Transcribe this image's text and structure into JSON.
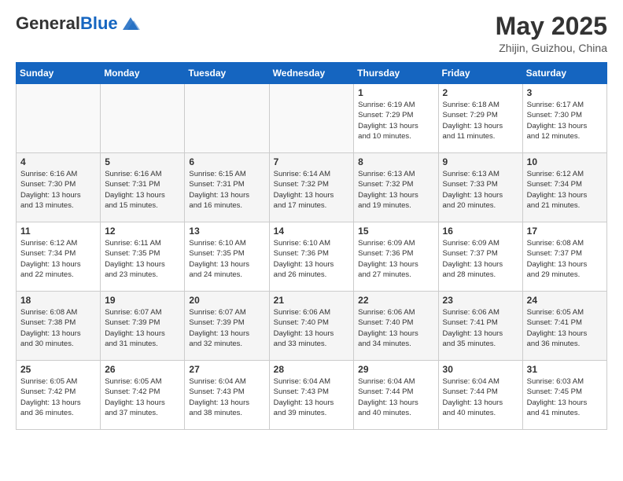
{
  "header": {
    "logo_general": "General",
    "logo_blue": "Blue",
    "month_title": "May 2025",
    "location": "Zhijin, Guizhou, China"
  },
  "weekdays": [
    "Sunday",
    "Monday",
    "Tuesday",
    "Wednesday",
    "Thursday",
    "Friday",
    "Saturday"
  ],
  "weeks": [
    [
      {
        "day": "",
        "info": ""
      },
      {
        "day": "",
        "info": ""
      },
      {
        "day": "",
        "info": ""
      },
      {
        "day": "",
        "info": ""
      },
      {
        "day": "1",
        "info": "Sunrise: 6:19 AM\nSunset: 7:29 PM\nDaylight: 13 hours\nand 10 minutes."
      },
      {
        "day": "2",
        "info": "Sunrise: 6:18 AM\nSunset: 7:29 PM\nDaylight: 13 hours\nand 11 minutes."
      },
      {
        "day": "3",
        "info": "Sunrise: 6:17 AM\nSunset: 7:30 PM\nDaylight: 13 hours\nand 12 minutes."
      }
    ],
    [
      {
        "day": "4",
        "info": "Sunrise: 6:16 AM\nSunset: 7:30 PM\nDaylight: 13 hours\nand 13 minutes."
      },
      {
        "day": "5",
        "info": "Sunrise: 6:16 AM\nSunset: 7:31 PM\nDaylight: 13 hours\nand 15 minutes."
      },
      {
        "day": "6",
        "info": "Sunrise: 6:15 AM\nSunset: 7:31 PM\nDaylight: 13 hours\nand 16 minutes."
      },
      {
        "day": "7",
        "info": "Sunrise: 6:14 AM\nSunset: 7:32 PM\nDaylight: 13 hours\nand 17 minutes."
      },
      {
        "day": "8",
        "info": "Sunrise: 6:13 AM\nSunset: 7:32 PM\nDaylight: 13 hours\nand 19 minutes."
      },
      {
        "day": "9",
        "info": "Sunrise: 6:13 AM\nSunset: 7:33 PM\nDaylight: 13 hours\nand 20 minutes."
      },
      {
        "day": "10",
        "info": "Sunrise: 6:12 AM\nSunset: 7:34 PM\nDaylight: 13 hours\nand 21 minutes."
      }
    ],
    [
      {
        "day": "11",
        "info": "Sunrise: 6:12 AM\nSunset: 7:34 PM\nDaylight: 13 hours\nand 22 minutes."
      },
      {
        "day": "12",
        "info": "Sunrise: 6:11 AM\nSunset: 7:35 PM\nDaylight: 13 hours\nand 23 minutes."
      },
      {
        "day": "13",
        "info": "Sunrise: 6:10 AM\nSunset: 7:35 PM\nDaylight: 13 hours\nand 24 minutes."
      },
      {
        "day": "14",
        "info": "Sunrise: 6:10 AM\nSunset: 7:36 PM\nDaylight: 13 hours\nand 26 minutes."
      },
      {
        "day": "15",
        "info": "Sunrise: 6:09 AM\nSunset: 7:36 PM\nDaylight: 13 hours\nand 27 minutes."
      },
      {
        "day": "16",
        "info": "Sunrise: 6:09 AM\nSunset: 7:37 PM\nDaylight: 13 hours\nand 28 minutes."
      },
      {
        "day": "17",
        "info": "Sunrise: 6:08 AM\nSunset: 7:37 PM\nDaylight: 13 hours\nand 29 minutes."
      }
    ],
    [
      {
        "day": "18",
        "info": "Sunrise: 6:08 AM\nSunset: 7:38 PM\nDaylight: 13 hours\nand 30 minutes."
      },
      {
        "day": "19",
        "info": "Sunrise: 6:07 AM\nSunset: 7:39 PM\nDaylight: 13 hours\nand 31 minutes."
      },
      {
        "day": "20",
        "info": "Sunrise: 6:07 AM\nSunset: 7:39 PM\nDaylight: 13 hours\nand 32 minutes."
      },
      {
        "day": "21",
        "info": "Sunrise: 6:06 AM\nSunset: 7:40 PM\nDaylight: 13 hours\nand 33 minutes."
      },
      {
        "day": "22",
        "info": "Sunrise: 6:06 AM\nSunset: 7:40 PM\nDaylight: 13 hours\nand 34 minutes."
      },
      {
        "day": "23",
        "info": "Sunrise: 6:06 AM\nSunset: 7:41 PM\nDaylight: 13 hours\nand 35 minutes."
      },
      {
        "day": "24",
        "info": "Sunrise: 6:05 AM\nSunset: 7:41 PM\nDaylight: 13 hours\nand 36 minutes."
      }
    ],
    [
      {
        "day": "25",
        "info": "Sunrise: 6:05 AM\nSunset: 7:42 PM\nDaylight: 13 hours\nand 36 minutes."
      },
      {
        "day": "26",
        "info": "Sunrise: 6:05 AM\nSunset: 7:42 PM\nDaylight: 13 hours\nand 37 minutes."
      },
      {
        "day": "27",
        "info": "Sunrise: 6:04 AM\nSunset: 7:43 PM\nDaylight: 13 hours\nand 38 minutes."
      },
      {
        "day": "28",
        "info": "Sunrise: 6:04 AM\nSunset: 7:43 PM\nDaylight: 13 hours\nand 39 minutes."
      },
      {
        "day": "29",
        "info": "Sunrise: 6:04 AM\nSunset: 7:44 PM\nDaylight: 13 hours\nand 40 minutes."
      },
      {
        "day": "30",
        "info": "Sunrise: 6:04 AM\nSunset: 7:44 PM\nDaylight: 13 hours\nand 40 minutes."
      },
      {
        "day": "31",
        "info": "Sunrise: 6:03 AM\nSunset: 7:45 PM\nDaylight: 13 hours\nand 41 minutes."
      }
    ]
  ]
}
